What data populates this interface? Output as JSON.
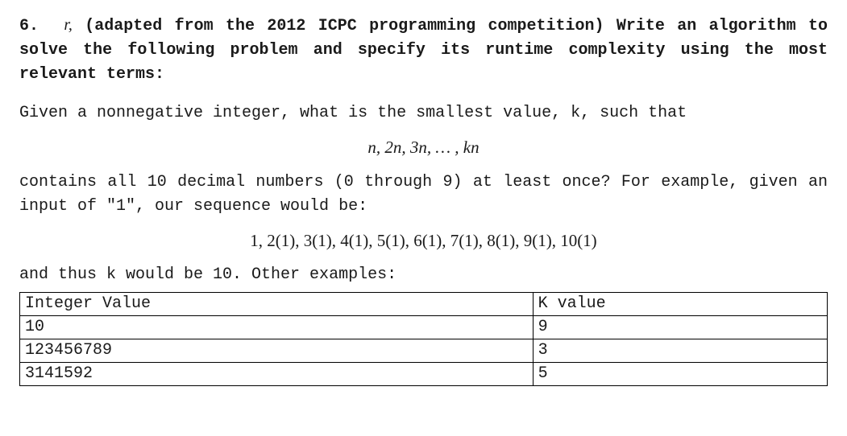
{
  "question": {
    "number": "6.",
    "r": "r,",
    "text_pre": "(adapted from the 2012 ICPC programming competition) Write an algorithm to solve the following problem and specify its runtime complexity using the most relevant terms:"
  },
  "body": {
    "given_line": "Given a nonnegative integer, what is the smallest value, k, such that",
    "sequence_def": "n, 2n, 3n, … , kn",
    "contains_line": "contains all 10 decimal numbers (0 through 9) at least once?  For example, given an input of \"1\", our sequence would be:",
    "example_seq": "1, 2(1), 3(1), 4(1), 5(1), 6(1), 7(1), 8(1), 9(1), 10(1)",
    "thus_line": "and thus k would be 10.  Other examples:"
  },
  "table": {
    "header": {
      "integer": "Integer Value",
      "k": "K value"
    },
    "rows": [
      {
        "integer": "10",
        "k": "9"
      },
      {
        "integer": "123456789",
        "k": "3"
      },
      {
        "integer": "3141592",
        "k": "5"
      }
    ]
  }
}
